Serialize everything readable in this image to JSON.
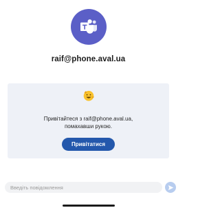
{
  "header": {
    "avatar_icon": "microsoft-teams-icon",
    "account": "raif@phone.aval.ua"
  },
  "greeting": {
    "emoji_icon": "waving-hand-emoji",
    "message_line1": "Привітайтеся з raif@phone.aval.ua,",
    "message_line2": "помахавши рукою.",
    "button_label": "Привітатися"
  },
  "composer": {
    "placeholder": "Введіть повідомлення",
    "value": "",
    "send_icon": "send-arrow-icon"
  },
  "colors": {
    "teams_purple": "#5b5fc7",
    "button_blue": "#2458ac",
    "card_background": "#eef1f7",
    "send_disabled": "#b8cdef"
  }
}
